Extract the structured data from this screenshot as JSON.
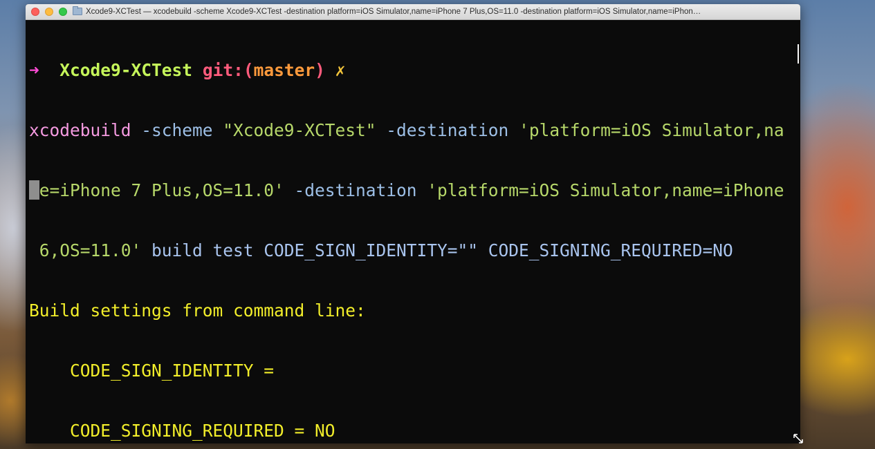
{
  "window": {
    "title": "Xcode9-XCTest — xcodebuild -scheme Xcode9-XCTest -destination platform=iOS Simulator,name=iPhone 7 Plus,OS=11.0 -destination platform=iOS Simulator,name=iPhon…"
  },
  "prompt": {
    "arrow": "➜",
    "directory": "Xcode9-XCTest",
    "git_label": "git:(",
    "branch": "master",
    "git_close": ")",
    "dirty_mark": "✗"
  },
  "command": {
    "line1": {
      "cmd": "xcodebuild",
      "p1": " -scheme ",
      "scheme": "\"Xcode9-XCTest\"",
      "p2": " -destination ",
      "dest": "'platform=iOS Simulator,na"
    },
    "line2": {
      "dest_cont": "me=iPhone 7 Plus,OS=11.0'",
      "p3": " -destination ",
      "dest2": "'platform=iOS Simulator,name=iPhone"
    },
    "line3": {
      "dest2_cont": " 6,OS=11.0'",
      "rest": " build test CODE_SIGN_IDENTITY=\"\" CODE_SIGNING_REQUIRED=NO"
    }
  },
  "output": {
    "header": "Build settings from command line:",
    "setting1": "    CODE_SIGN_IDENTITY = ",
    "setting2": "    CODE_SIGNING_REQUIRED = NO"
  },
  "colors": {
    "terminal_bg": "#0b0b0b",
    "output_yellow": "#f2ee2a",
    "prompt_arrow": "#ff4cd6",
    "directory_green": "#c5f55a"
  }
}
